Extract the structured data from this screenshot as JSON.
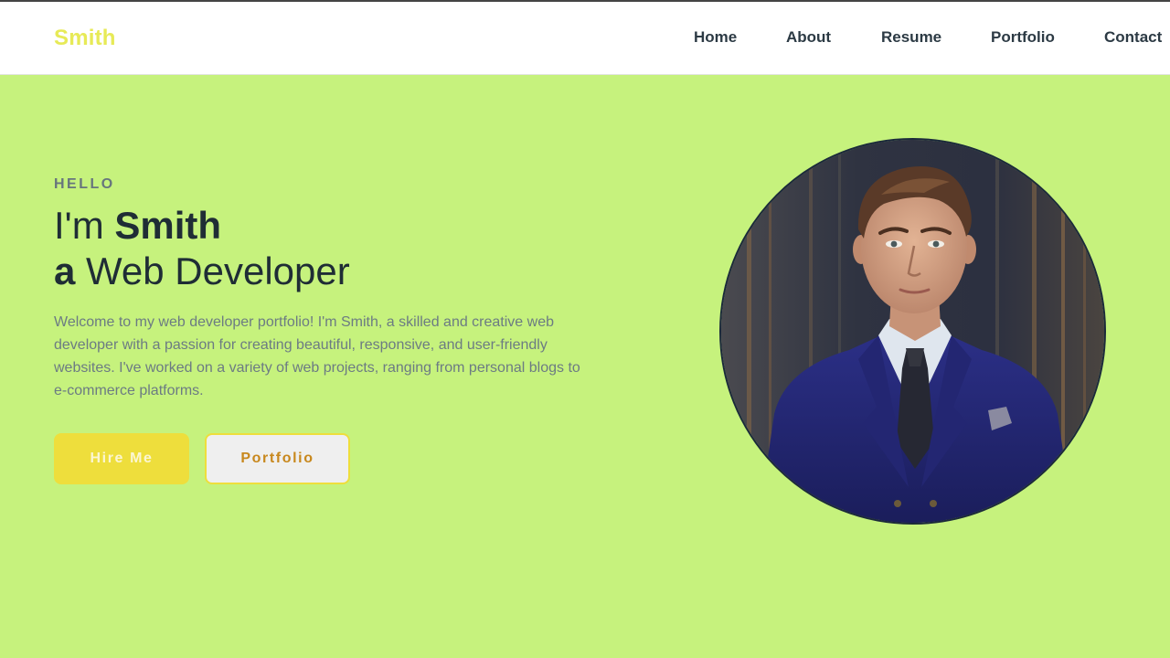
{
  "header": {
    "logo": "Smith",
    "nav": [
      {
        "label": "Home"
      },
      {
        "label": "About"
      },
      {
        "label": "Resume"
      },
      {
        "label": "Portfolio"
      },
      {
        "label": "Contact"
      }
    ]
  },
  "hero": {
    "kicker": "HELLO",
    "title_line1_prefix": "I'm ",
    "title_line1_name": "Smith",
    "title_line2_article": "a",
    "title_line2_role": " Web Developer",
    "description": "Welcome to my web developer portfolio! I'm Smith, a skilled and creative web developer with a passion for creating beautiful, responsive, and user-friendly websites. I've worked on a variety of web projects, ranging from personal blogs to e-commerce platforms.",
    "buttons": {
      "hire_label": "Hire Me",
      "portfolio_label": "Portfolio"
    }
  },
  "colors": {
    "background": "#c6f27d",
    "accent_yellow": "#eede3c",
    "text_dark": "#1f2d35"
  },
  "images": {
    "profile_icon": "profile-photo-man-in-suit"
  }
}
